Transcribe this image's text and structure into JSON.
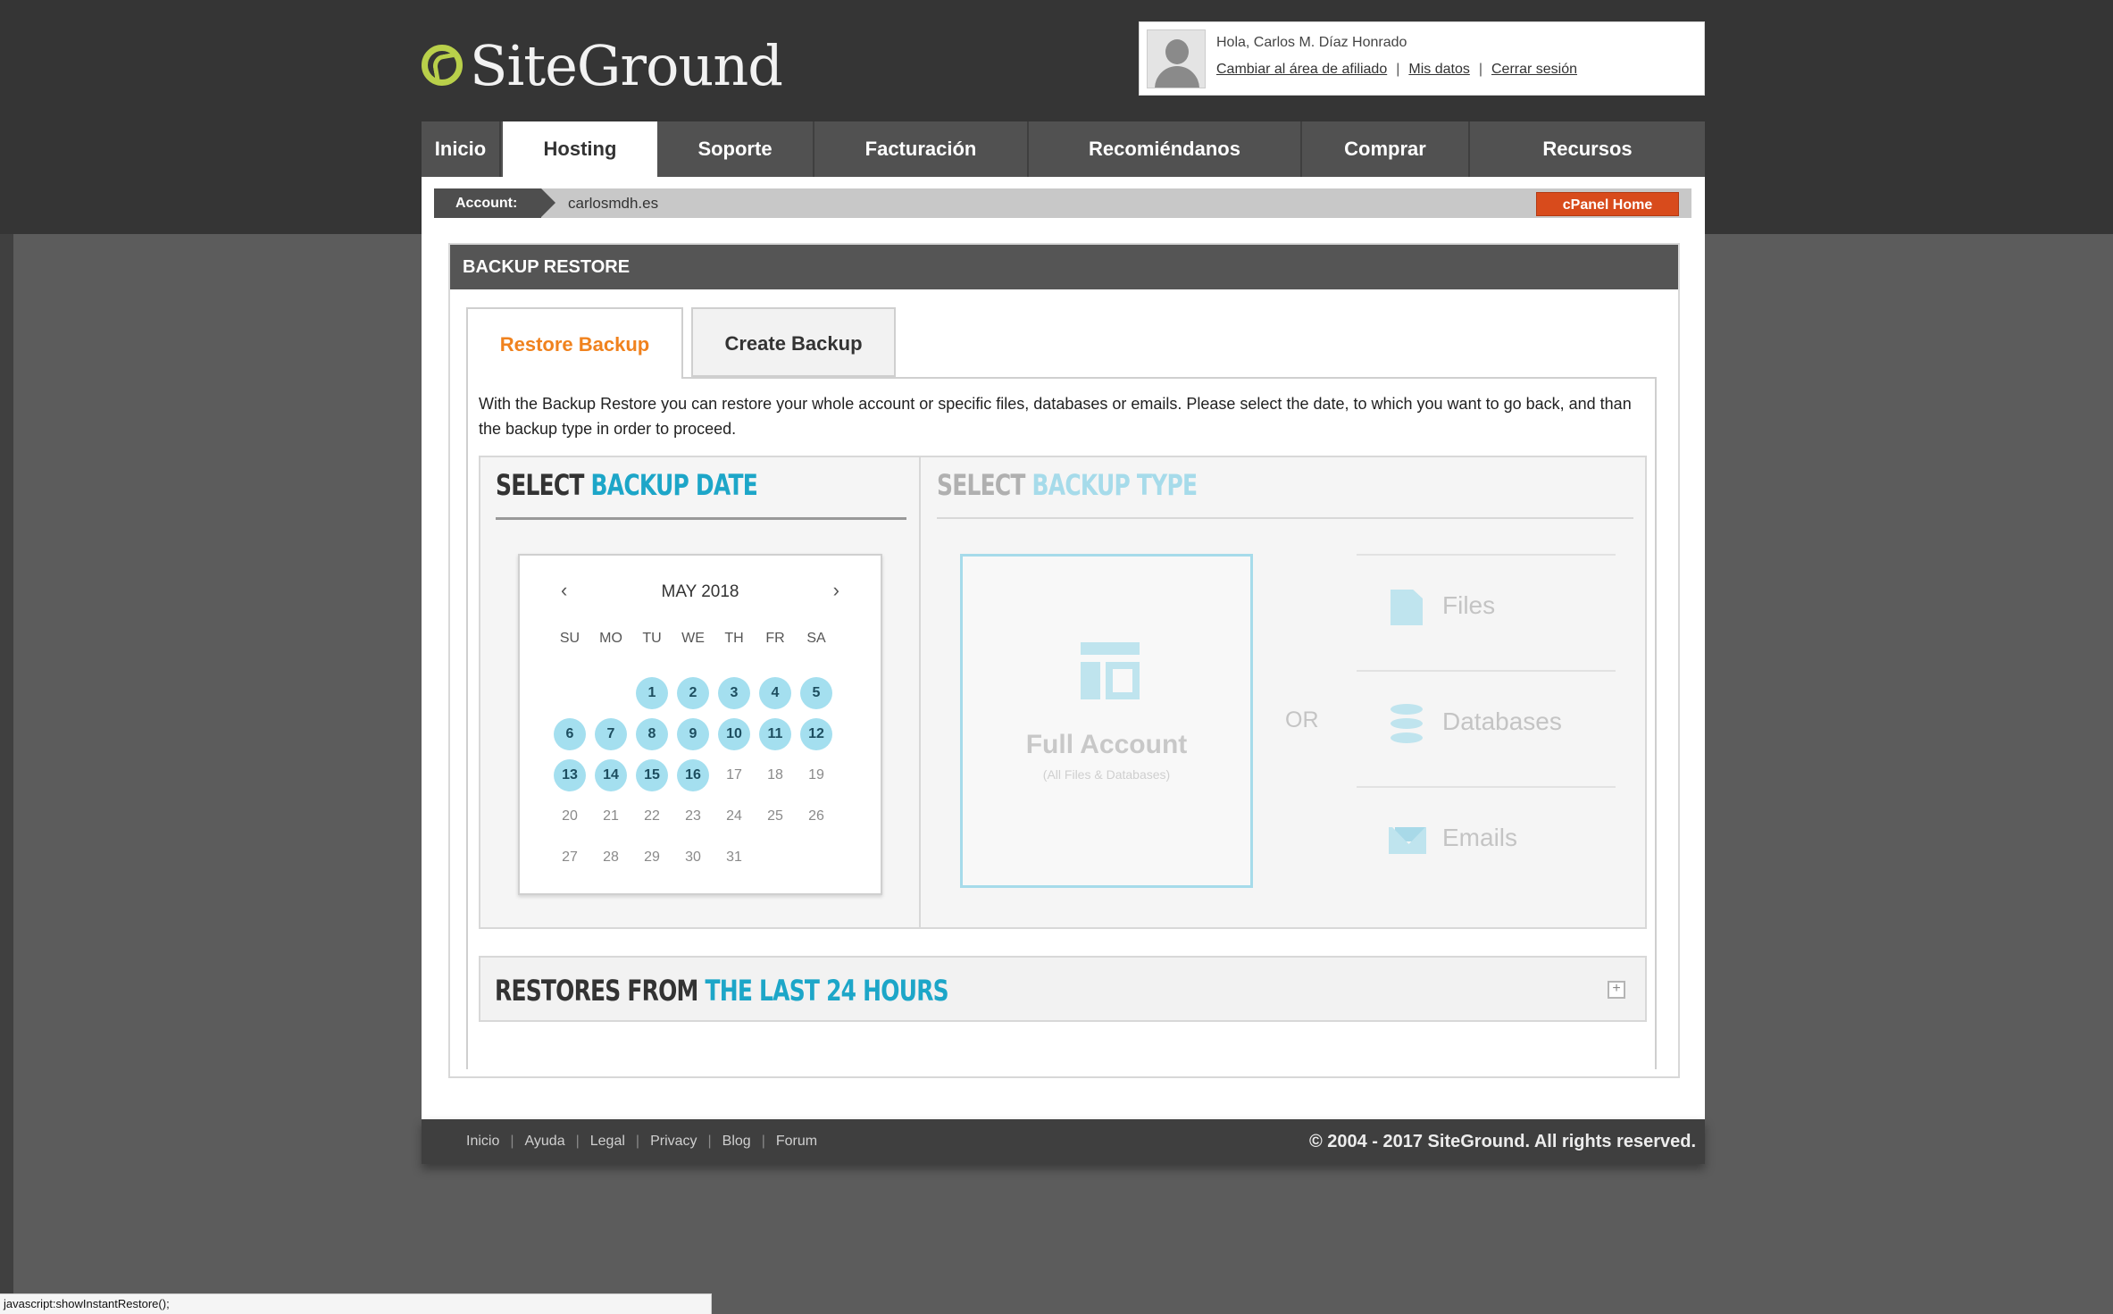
{
  "header": {
    "logo_text": "SiteGround",
    "greeting": "Hola, Carlos M. Díaz Honrado",
    "links": [
      "Cambiar al área de afiliado",
      "Mis datos",
      "Cerrar sesión"
    ]
  },
  "nav": {
    "tabs": [
      "Inicio",
      "Hosting",
      "Soporte",
      "Facturación",
      "Recomiéndanos",
      "Comprar",
      "Recursos"
    ],
    "active": "Hosting"
  },
  "account": {
    "label": "Account:",
    "value": "carlosmdh.es",
    "cpanel_button": "cPanel Home"
  },
  "box": {
    "title": "BACKUP RESTORE",
    "tabs": [
      "Restore Backup",
      "Create Backup"
    ],
    "active_tab": "Restore Backup",
    "description": "With the Backup Restore you can restore your whole account or specific files, databases or emails. Please select the date, to which you want to go back, and than the backup type in order to proceed."
  },
  "date_section": {
    "title_plain": "SELECT ",
    "title_accent": "BACKUP DATE"
  },
  "calendar": {
    "prev_icon": "‹",
    "next_icon": "›",
    "month_label": "MAY 2018",
    "weekdays": [
      "SU",
      "MO",
      "TU",
      "WE",
      "TH",
      "FR",
      "SA"
    ],
    "first_weekday_index": 2,
    "days_in_month": 31,
    "available_days": [
      1,
      2,
      3,
      4,
      5,
      6,
      7,
      8,
      9,
      10,
      11,
      12,
      13,
      14,
      15,
      16
    ]
  },
  "type_section": {
    "title_plain": "SELECT ",
    "title_accent": "BACKUP TYPE",
    "full_account_label": "Full Account",
    "full_account_sub": "(All Files & Databases)",
    "or_label": "OR",
    "options": [
      {
        "label": "Files",
        "icon": "file-icon"
      },
      {
        "label": "Databases",
        "icon": "database-icon"
      },
      {
        "label": "Emails",
        "icon": "envelope-icon"
      }
    ]
  },
  "restores": {
    "title_plain": "RESTORES FROM ",
    "title_accent": "THE LAST 24 HOURS",
    "expand_icon": "+"
  },
  "footer": {
    "links": [
      "Inicio",
      "Ayuda",
      "Legal",
      "Privacy",
      "Blog",
      "Forum"
    ],
    "copyright": "© 2004 - 2017 SiteGround. All rights reserved."
  },
  "status_bar": "javascript:showInstantRestore();",
  "colors": {
    "accent": "#1da6c8",
    "active_tab_text": "#f0821e",
    "cpanel_button": "#d84b1c",
    "calendar_available": "#a4dfef"
  }
}
